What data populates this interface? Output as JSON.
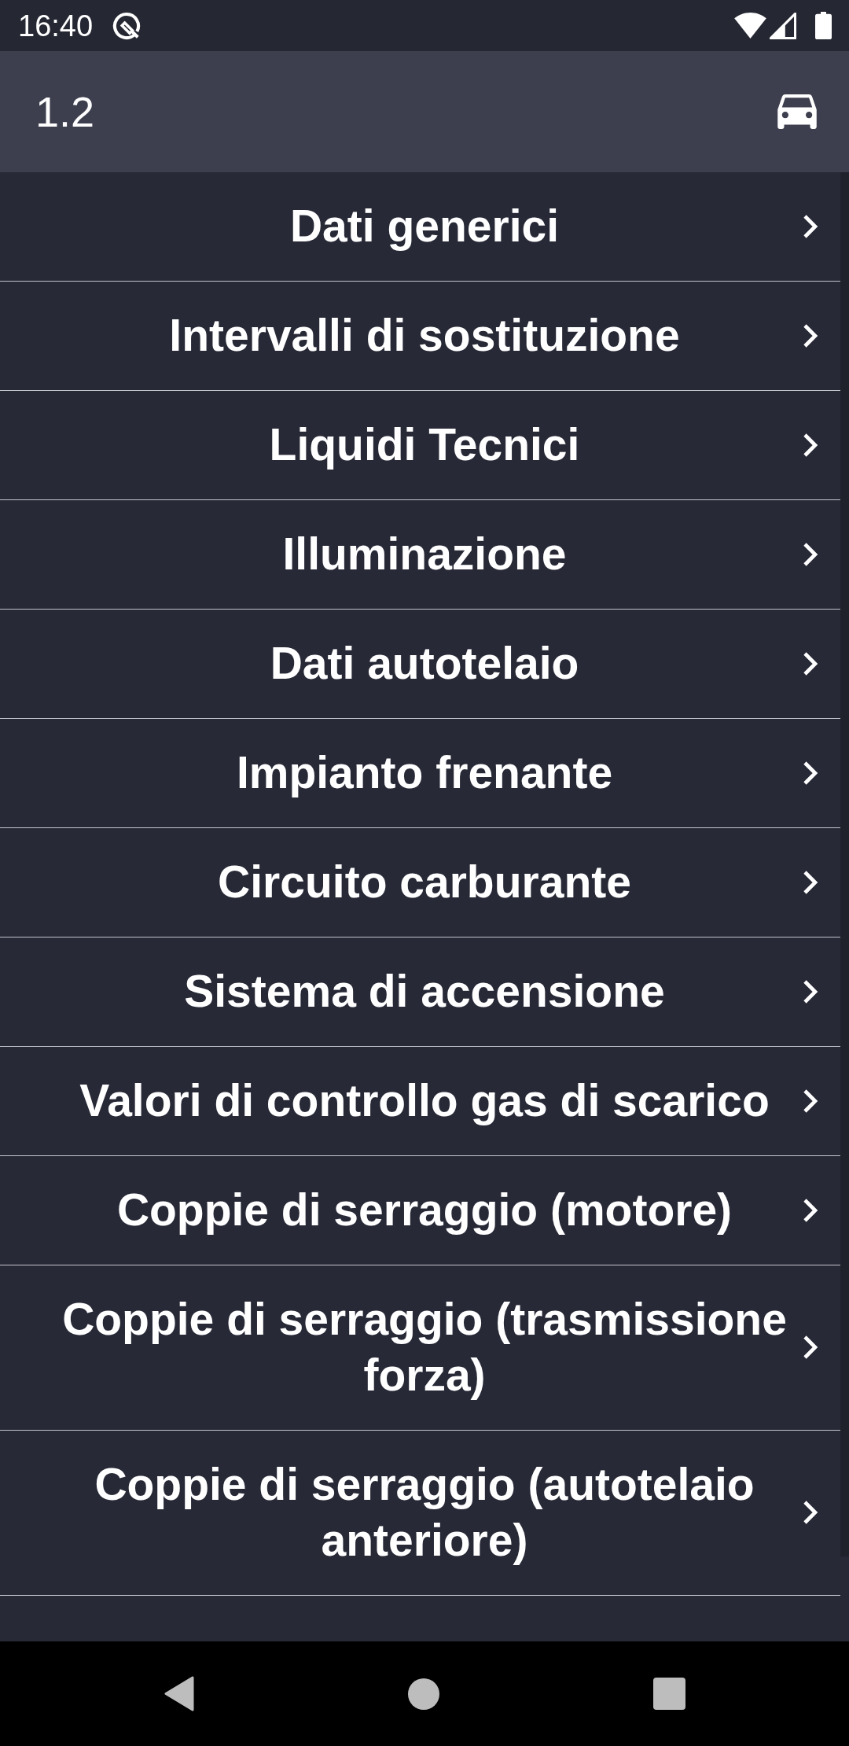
{
  "status_bar": {
    "time": "16:40"
  },
  "toolbar": {
    "title": "1.2"
  },
  "menu_items": [
    {
      "label": "Dati generici"
    },
    {
      "label": "Intervalli di sostituzione"
    },
    {
      "label": "Liquidi Tecnici"
    },
    {
      "label": "Illuminazione"
    },
    {
      "label": "Dati autotelaio"
    },
    {
      "label": "Impianto frenante"
    },
    {
      "label": "Circuito carburante"
    },
    {
      "label": "Sistema di accensione"
    },
    {
      "label": "Valori di controllo gas di scarico"
    },
    {
      "label": "Coppie di serraggio (motore)"
    },
    {
      "label": "Coppie di serraggio (trasmissione forza)"
    },
    {
      "label": "Coppie di serraggio (autotelaio anteriore)"
    }
  ]
}
